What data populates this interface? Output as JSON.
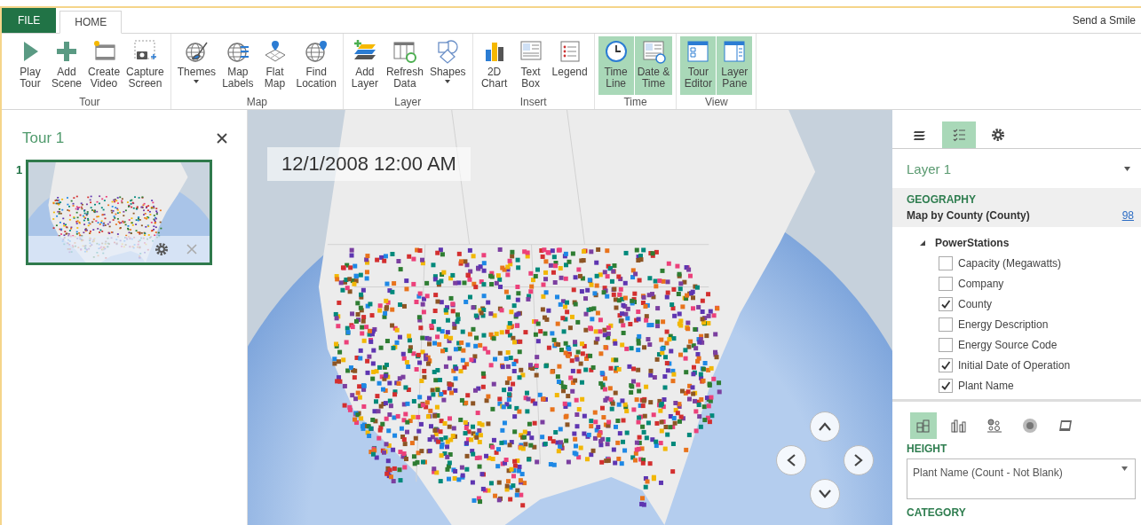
{
  "top_bar": {
    "tabs": [
      {
        "label": "FILE",
        "kind": "file",
        "selected": false
      },
      {
        "label": "HOME",
        "kind": "tab",
        "selected": true
      }
    ],
    "send_smile": "Send a Smile"
  },
  "ribbon": {
    "groups": [
      {
        "name": "Tour",
        "buttons": [
          {
            "label": "Play\nTour",
            "selected": false
          },
          {
            "label": "Add\nScene",
            "selected": false
          },
          {
            "label": "Create\nVideo",
            "selected": false
          },
          {
            "label": "Capture\nScreen",
            "selected": false
          }
        ]
      },
      {
        "name": "Map",
        "buttons": [
          {
            "label": "Themes",
            "selected": false,
            "dropdown": true
          },
          {
            "label": "Map\nLabels",
            "selected": false
          },
          {
            "label": "Flat\nMap",
            "selected": false
          },
          {
            "label": "Find\nLocation",
            "selected": false
          }
        ]
      },
      {
        "name": "Layer",
        "buttons": [
          {
            "label": "Add\nLayer",
            "selected": false
          },
          {
            "label": "Refresh\nData",
            "selected": false
          },
          {
            "label": "Shapes",
            "selected": false,
            "dropdown": true
          }
        ]
      },
      {
        "name": "Insert",
        "buttons": [
          {
            "label": "2D\nChart",
            "selected": false
          },
          {
            "label": "Text\nBox",
            "selected": false
          },
          {
            "label": "Legend",
            "selected": false
          }
        ]
      },
      {
        "name": "Time",
        "buttons": [
          {
            "label": "Time\nLine",
            "selected": true
          },
          {
            "label": "Date &\nTime",
            "selected": true
          }
        ]
      },
      {
        "name": "View",
        "buttons": [
          {
            "label": "Tour\nEditor",
            "selected": true
          },
          {
            "label": "Layer\nPane",
            "selected": true
          }
        ]
      }
    ]
  },
  "tour_pane": {
    "title": "Tour 1",
    "scenes": [
      {
        "number": "1",
        "selected": true
      }
    ]
  },
  "map": {
    "date_time": "12/1/2008 12:00 AM"
  },
  "layer_pane": {
    "tabs": [
      {
        "selected": false
      },
      {
        "selected": true
      },
      {
        "selected": false
      }
    ],
    "layer_name": "Layer 1",
    "geography": {
      "heading": "GEOGRAPHY",
      "value": "Map by County (County)",
      "link": "98"
    },
    "table": {
      "name": "PowerStations",
      "expanded": true,
      "fields": [
        {
          "label": "Capacity (Megawatts)",
          "checked": false
        },
        {
          "label": "Company",
          "checked": false
        },
        {
          "label": "County",
          "checked": true
        },
        {
          "label": "Energy Description",
          "checked": false
        },
        {
          "label": "Energy Source Code",
          "checked": false
        },
        {
          "label": "Initial Date of Operation",
          "checked": true
        },
        {
          "label": "Plant Name",
          "checked": true
        }
      ]
    },
    "visual_types": [
      {
        "selected": true
      },
      {
        "selected": false
      },
      {
        "selected": false
      },
      {
        "selected": false
      },
      {
        "selected": false
      }
    ],
    "height": {
      "heading": "HEIGHT",
      "value": "Plant Name (Count - Not Blank)"
    },
    "category": {
      "heading": "CATEGORY"
    }
  }
}
